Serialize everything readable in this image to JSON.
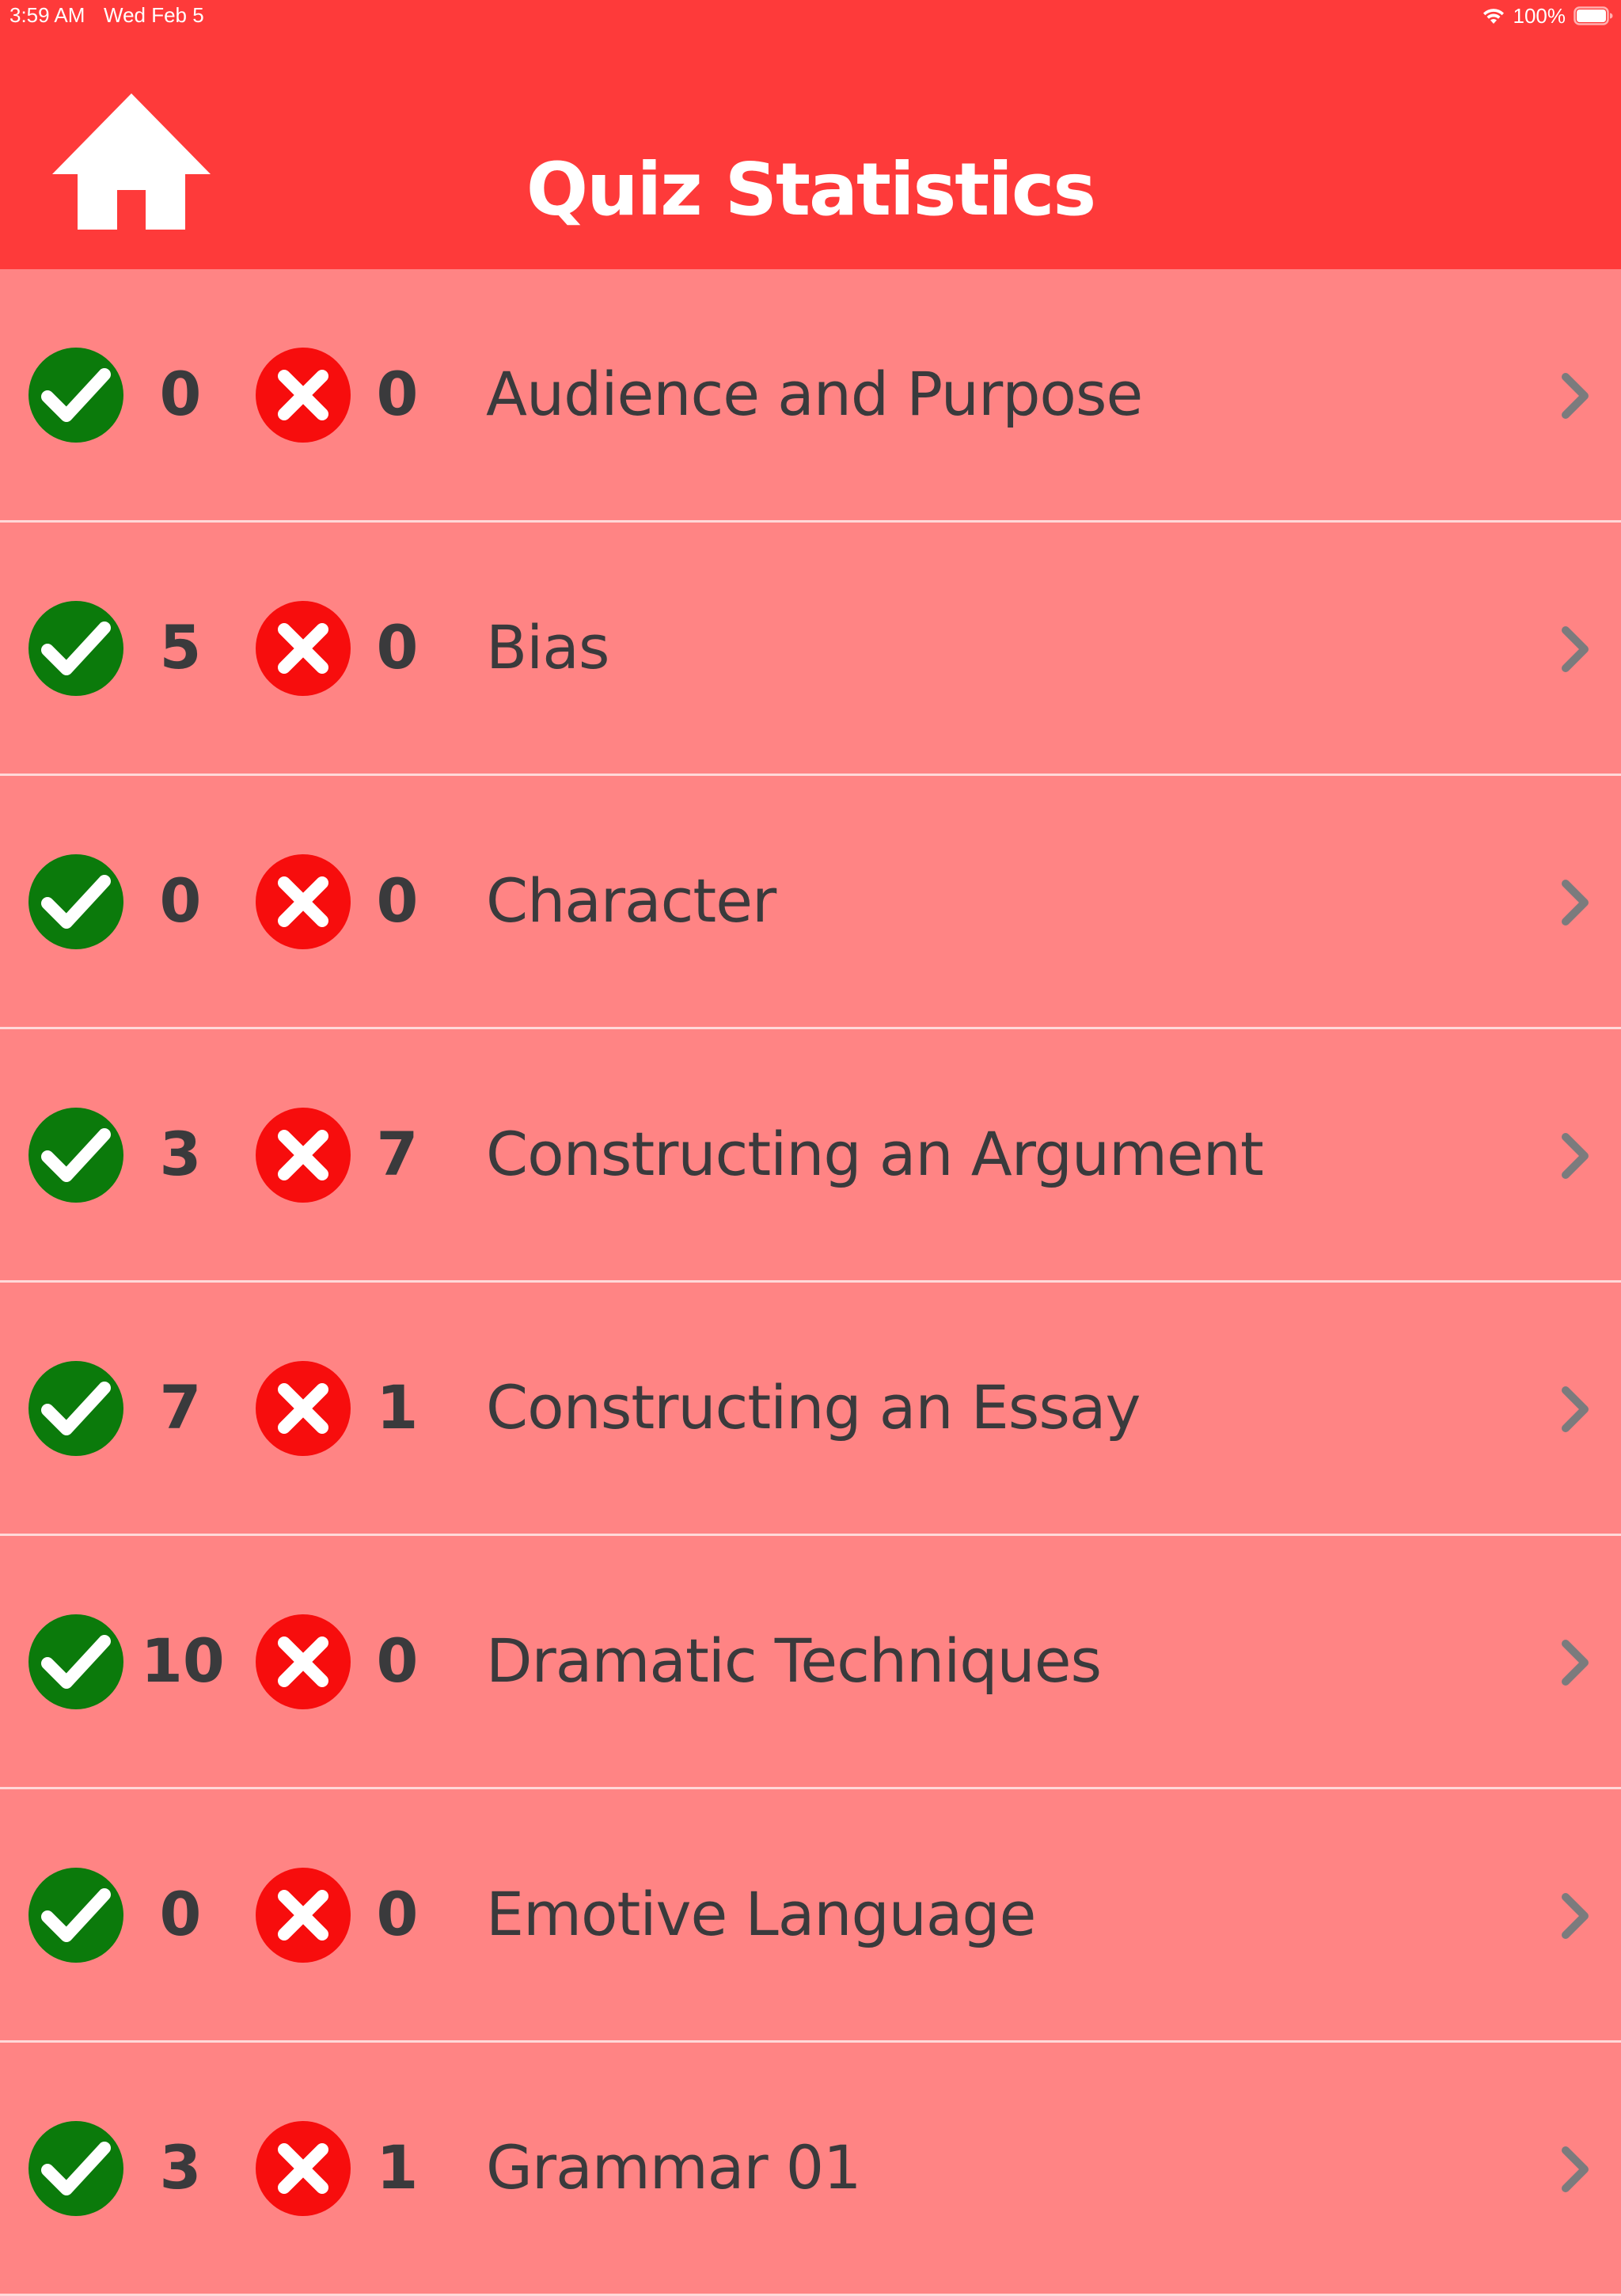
{
  "status_bar": {
    "time": "3:59 AM",
    "date": "Wed Feb 5",
    "battery": "100%"
  },
  "header": {
    "title": "Quiz Statistics",
    "home_icon": "home-icon"
  },
  "colors": {
    "header_bg": "#fe3a3a",
    "row_bg": "#ff8484",
    "correct": "#0b7a0b",
    "wrong": "#f70d0d",
    "text": "#3a3a3c"
  },
  "topics": [
    {
      "correct": "0",
      "wrong": "0",
      "name": "Audience and Purpose"
    },
    {
      "correct": "5",
      "wrong": "0",
      "name": "Bias"
    },
    {
      "correct": "0",
      "wrong": "0",
      "name": "Character"
    },
    {
      "correct": "3",
      "wrong": "7",
      "name": "Constructing an Argument"
    },
    {
      "correct": "7",
      "wrong": "1",
      "name": "Constructing an Essay"
    },
    {
      "correct": "10",
      "wrong": "0",
      "name": "Dramatic Techniques"
    },
    {
      "correct": "0",
      "wrong": "0",
      "name": "Emotive Language"
    },
    {
      "correct": "3",
      "wrong": "1",
      "name": "Grammar 01"
    }
  ]
}
